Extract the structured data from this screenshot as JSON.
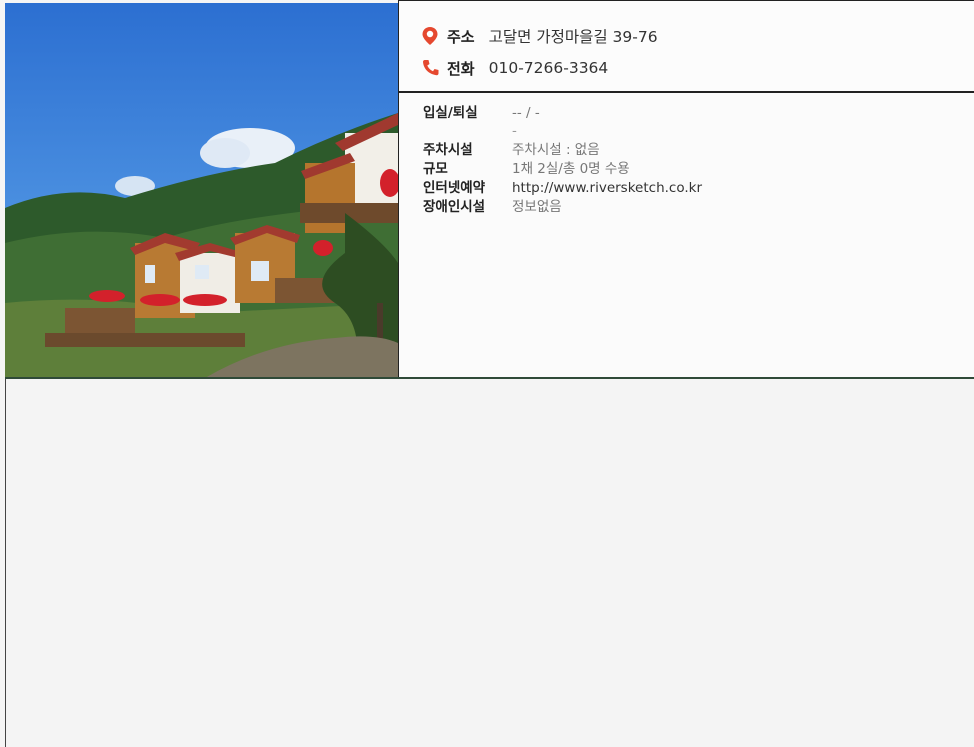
{
  "photo": {
    "alt": "Pension buildings on a hillside"
  },
  "contact": {
    "address_label": "주소",
    "address_value": "고달면 가정마을길 39-76",
    "phone_label": "전화",
    "phone_value": "010-7266-3364",
    "icons": {
      "address": "map-pin-icon",
      "phone": "phone-icon"
    },
    "accent_color": "#e5482f"
  },
  "details": {
    "checkin_label": "입실/퇴실",
    "checkin_value": "-- / -",
    "checkin_value2": "-",
    "parking_label": "주차시설",
    "parking_value": "주차시설 : 없음",
    "scale_label": "규모",
    "scale_value": "1채 2실/총 0명 수용",
    "web_label": "인터넷예약",
    "web_value": "http://www.riversketch.co.kr",
    "access_label": "장애인시설",
    "access_value": "정보없음"
  }
}
